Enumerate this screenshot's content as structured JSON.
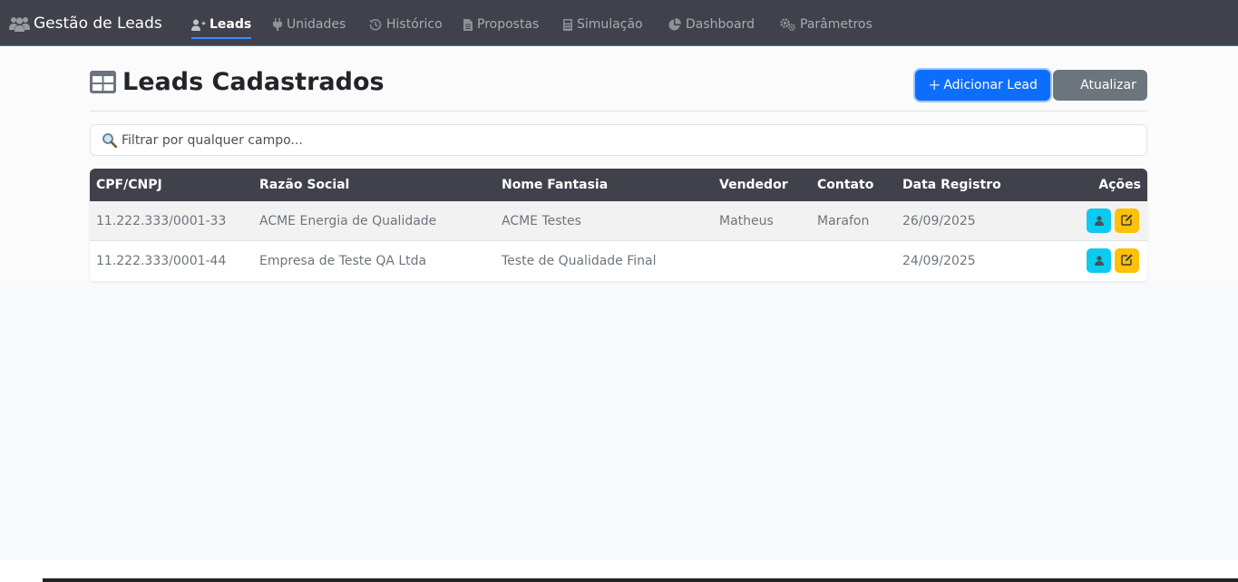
{
  "app": {
    "brand": "Gestão de Leads",
    "brand_icon": "users-icon"
  },
  "nav": {
    "items": [
      {
        "label": "Leads",
        "icon": "user-plus-icon",
        "active": true
      },
      {
        "label": "Unidades",
        "icon": "plug-icon"
      },
      {
        "label": "Histórico",
        "icon": "history-icon"
      },
      {
        "label": "Propostas",
        "icon": "document-icon"
      },
      {
        "label": "Simulação",
        "icon": "calculator-icon"
      },
      {
        "label": "Dashboard",
        "icon": "pie-chart-icon"
      },
      {
        "label": "Parâmetros",
        "icon": "gears-icon"
      }
    ]
  },
  "page": {
    "title": "Leads Cadastrados",
    "title_icon": "table-icon",
    "add_button": "Adicionar Lead",
    "refresh_button": "Atualizar"
  },
  "search": {
    "placeholder": "Filtrar por qualquer campo...",
    "value": ""
  },
  "table": {
    "columns": [
      "CPF/CNPJ",
      "Razão Social",
      "Nome Fantasia",
      "Vendedor",
      "Contato",
      "Data Registro",
      "Ações"
    ],
    "rows": [
      {
        "cpf_cnpj": "11.222.333/0001-33",
        "razao_social": "ACME Energia de Qualidade",
        "nome_fantasia": "ACME Testes",
        "vendedor": "Matheus",
        "contato": "Marafon",
        "data_registro": "26/09/2025"
      },
      {
        "cpf_cnpj": "11.222.333/0001-44",
        "razao_social": "Empresa de Teste QA Ltda",
        "nome_fantasia": "Teste de Qualidade Final",
        "vendedor": "",
        "contato": "",
        "data_registro": "24/09/2025"
      }
    ],
    "actions": [
      "user-icon",
      "edit-icon"
    ]
  },
  "colors": {
    "navbar": "#40414a",
    "primary": "#0d6efd",
    "secondary": "#6c757d",
    "info": "#0dcaf0",
    "warning": "#ffc107"
  }
}
